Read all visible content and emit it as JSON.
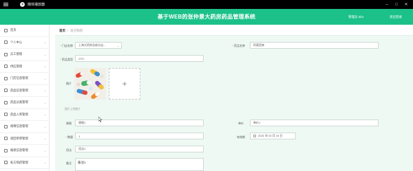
{
  "window": {
    "title": "媒体播放器",
    "controls": [
      "–",
      "□",
      "✕"
    ]
  },
  "header": {
    "app_title": "基于WEB的张仲景大药房药品管理系统",
    "user": "管理员 abo",
    "logout": "退出登录"
  },
  "sidebar": {
    "items": [
      {
        "label": "首页",
        "icon": "home-icon"
      },
      {
        "label": "个人中心",
        "icon": "user-icon"
      },
      {
        "label": "员工管理",
        "icon": "staff-icon"
      },
      {
        "label": "供应管理",
        "icon": "supply-icon"
      },
      {
        "label": "门店信息管理",
        "icon": "store-icon"
      },
      {
        "label": "药品信息管理",
        "icon": "drug-icon"
      },
      {
        "label": "药品分类管理",
        "icon": "category-icon"
      },
      {
        "label": "药品入库管理",
        "icon": "inbound-icon"
      },
      {
        "label": "病情信息管理",
        "icon": "condition-icon"
      },
      {
        "label": "退回单审管理",
        "icon": "return-icon"
      },
      {
        "label": "报损信息管理",
        "icon": "loss-icon"
      },
      {
        "label": "处方购药管理",
        "icon": "prescription-icon"
      }
    ]
  },
  "breadcrumb": {
    "home": "首页",
    "separator": "/",
    "current": "处方购药"
  },
  "form": {
    "store_label": "门店名称",
    "store_value": "上海大药房总部分店...",
    "drug_name_label": "药品名称",
    "drug_name_value": "阿莫西林",
    "drug_type_label": "药品类型",
    "drug_type_value": "OTC",
    "image_label": "图片",
    "upload_hint": "图片上传图片",
    "spec_label": "规格",
    "spec_value": "规格1",
    "price_label": "单价",
    "price_value": "单价1",
    "qty_label": "数量",
    "qty_value": "1",
    "date_label": "有效期",
    "date_value": "2021 年 02 月 15 日",
    "usage_label": "用法",
    "usage_value": "用法1",
    "note_label": "备注",
    "note_value": "备注1"
  }
}
